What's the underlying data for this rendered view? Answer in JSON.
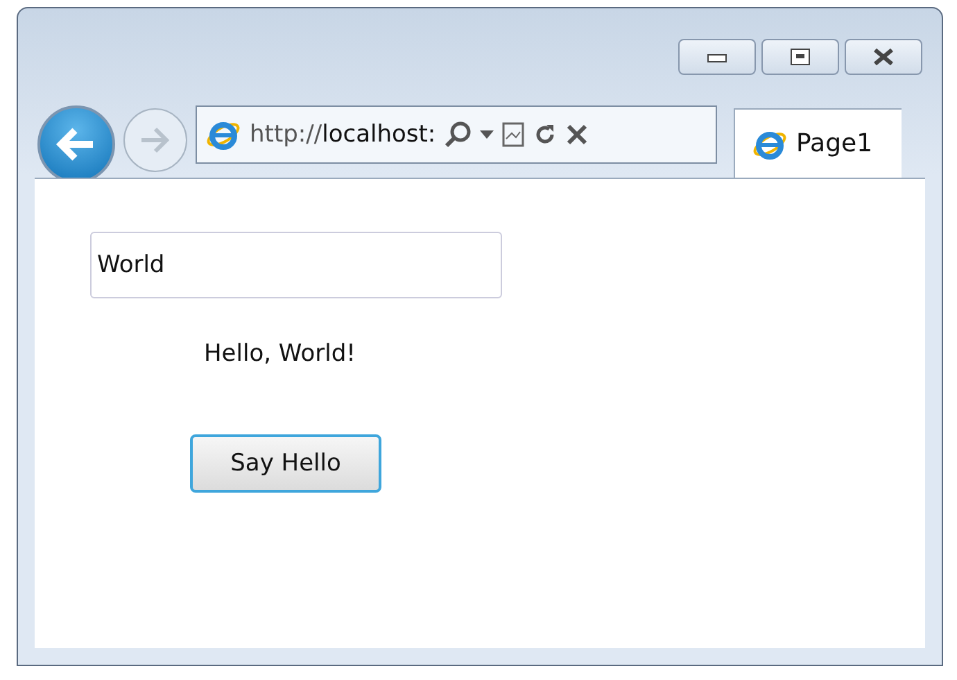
{
  "address_bar": {
    "url": "http://**localhost:**"
  },
  "tabs": [
    {
      "label": "Page1",
      "selected": true
    }
  ],
  "page": {
    "input": {
      "value": "World"
    },
    "greeting": "Hello, World!",
    "button": "Say Hello"
  }
}
